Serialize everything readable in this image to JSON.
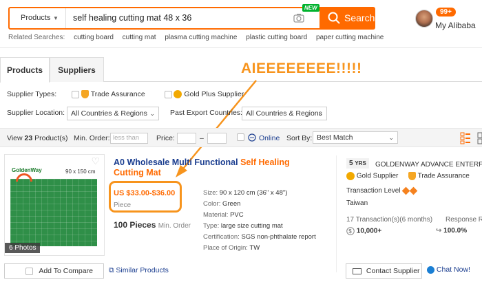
{
  "header": {
    "category_label": "Products",
    "search_value": "self healing cutting mat 48 x 36",
    "new_badge": "NEW",
    "search_button": "Search",
    "related_label": "Related Searches:",
    "related": [
      "cutting board",
      "cutting mat",
      "plasma cutting machine",
      "plastic cutting board",
      "paper cutting machine"
    ],
    "notif_count": "99+",
    "account_label": "My Alibaba"
  },
  "tabs": [
    "Products",
    "Suppliers"
  ],
  "annotation": "AIEEEEEEEE!!!!!",
  "filters": {
    "supplier_types_label": "Supplier Types:",
    "trade_assurance": "Trade Assurance",
    "gold_plus": "Gold Plus Supplier",
    "location_label": "Supplier Location:",
    "location_value": "All Countries & Regions",
    "export_label": "Past Export Countries:",
    "export_value": "All Countries & Regions"
  },
  "viewbar": {
    "view_prefix": "View",
    "count": "23",
    "view_suffix": "Product(s)",
    "min_order_label": "Min. Order:",
    "min_order_placeholder": "less than",
    "price_label": "Price:",
    "dash": "–",
    "online_label": "Online",
    "sort_label": "Sort By:",
    "sort_value": "Best Match"
  },
  "product": {
    "logo_text": "GoldenWay",
    "size_badge": "90 x 150 cm",
    "photos": "6 Photos",
    "title_blue": "A0 Wholesale Multi Functional",
    "title_orange": "Self Healing Cutting Mat",
    "price": "US $33.00-$36.00",
    "unit": "Piece",
    "moq_qty": "100 Pieces",
    "moq_label": "Min. Order",
    "attributes": [
      {
        "k": "Size:",
        "v": "90 x 120 cm (36\" x 48\")"
      },
      {
        "k": "Color:",
        "v": "Green"
      },
      {
        "k": "Material:",
        "v": "PVC"
      },
      {
        "k": "Type:",
        "v": "large size cutting mat"
      },
      {
        "k": "Certification:",
        "v": "SGS non-phthalate report"
      },
      {
        "k": "Place of Origin:",
        "v": "TW"
      }
    ],
    "compare_label": "Add To Compare",
    "similar_label": "Similar Products"
  },
  "supplier": {
    "years": "5",
    "years_unit": "YRS",
    "name": "GOLDENWAY ADVANCE ENTERPRIS",
    "gold": "Gold Supplier",
    "trade": "Trade Assurance",
    "tx_level_label": "Transaction Level",
    "country": "Taiwan",
    "tx_count": "17 Transaction(s)(6 months)",
    "tx_value": "10,000+",
    "resp_label": "Response Rate",
    "resp_value": "100.0%",
    "contact_label": "Contact Supplier",
    "chat_label": "Chat Now!"
  },
  "colors": {
    "accent": "#ff6a00",
    "annotation": "#f7941d",
    "link": "#1a3d8f"
  }
}
